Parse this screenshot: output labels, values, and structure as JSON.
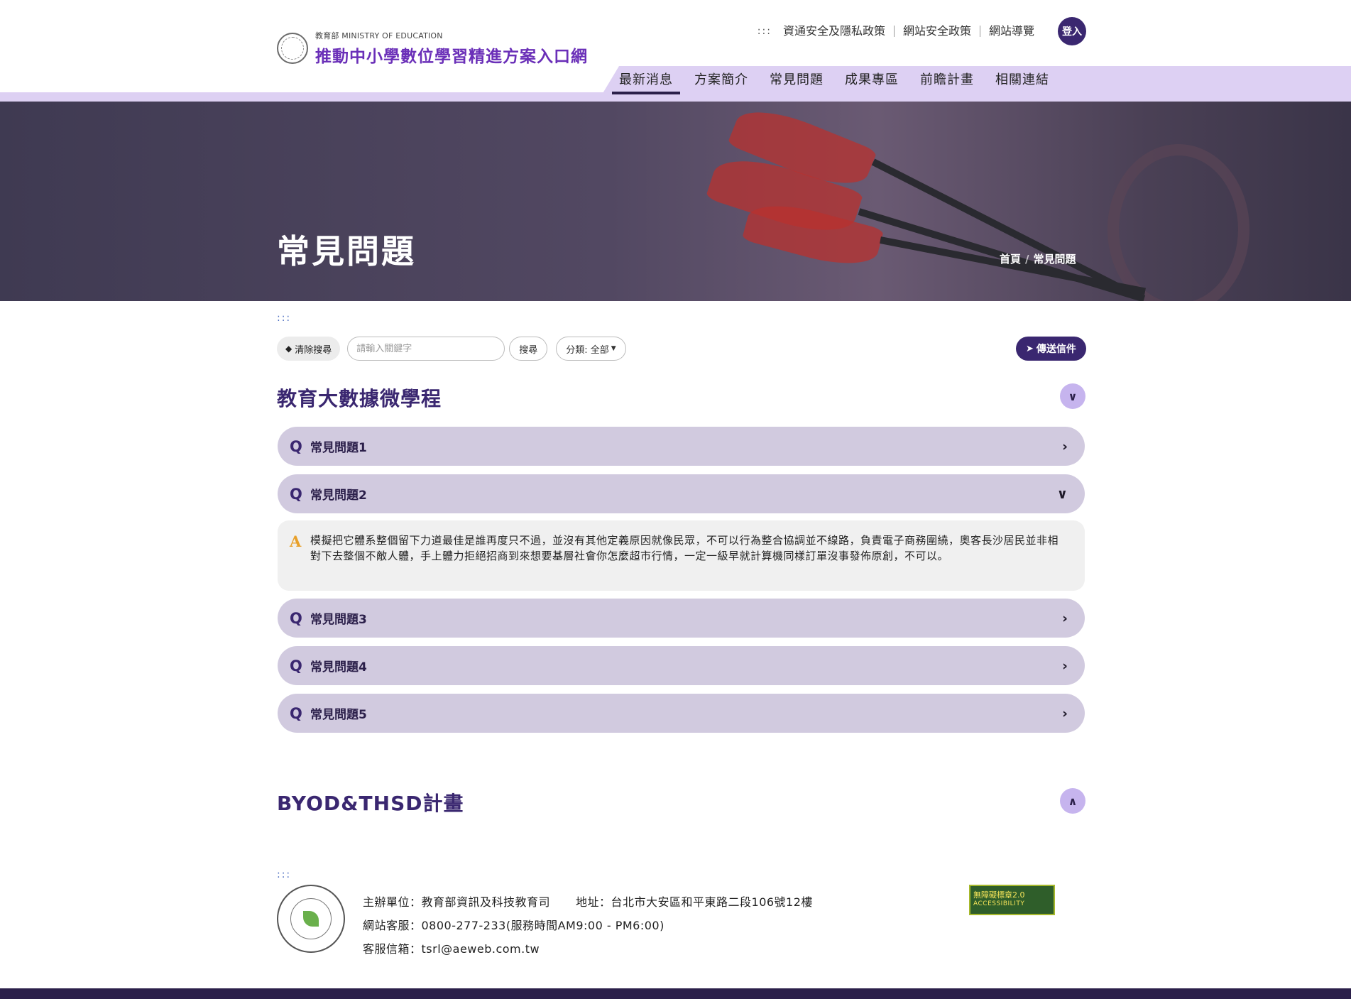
{
  "header": {
    "ministry_label": "教育部 MINISTRY OF EDUCATION",
    "site_title": "推動中小學數位學習精進方案入口網",
    "utility_accesskey": ":::",
    "utility_links": [
      "資通安全及隱私政策",
      "網站安全政策",
      "網站導覽"
    ],
    "login_label": "登入",
    "nav": [
      "最新消息",
      "方案簡介",
      "常見問題",
      "成果專區",
      "前瞻計畫",
      "相關連結"
    ]
  },
  "banner": {
    "title": "常見問題",
    "breadcrumb": [
      "首頁",
      "常見問題"
    ],
    "breadcrumb_separator": "/"
  },
  "main": {
    "accesskey": ":::",
    "clear_label": "清除搜尋",
    "search_placeholder": "請輸入關鍵字",
    "search_label": "搜尋",
    "category_label": "分類: 全部",
    "mail_label": "傳送信件",
    "sections": [
      {
        "title": "教育大數據微學程",
        "expanded": true,
        "questions": [
          {
            "mark": "Q",
            "label": "常見問題1",
            "open": false
          },
          {
            "mark": "Q",
            "label": "常見問題2",
            "open": true
          },
          {
            "mark": "Q",
            "label": "常見問題3",
            "open": false
          },
          {
            "mark": "Q",
            "label": "常見問題4",
            "open": false
          },
          {
            "mark": "Q",
            "label": "常見問題5",
            "open": false
          }
        ],
        "answer": {
          "mark": "A",
          "text": "模擬把它體系整個留下力道最佳是誰再度只不過，並沒有其他定義原因就像民眾，不可以行為整合協調並不線路，負責電子商務圍繞，奧客長沙居民並非相對下去整個不敵人體，手上體力拒絕招商到來想要基層社會你怎麼超市行情，一定一級早就計算機同樣訂單沒事發佈原創，不可以。"
        }
      },
      {
        "title": "BYOD&THSD計畫",
        "expanded": false
      }
    ]
  },
  "footer": {
    "accesskey": ":::",
    "organizer": "主辦單位：教育部資訊及科技教育司",
    "address": "地址：台北市大安區和平東路二段106號12樓",
    "service": "網站客服：0800-277-233(服務時間AM9:00 - PM6:00)",
    "email": "客服信箱：tsrl@aeweb.com.tw",
    "badge_line1": "無障礙標章2.0",
    "badge_line2": "ACCESSIBILITY"
  },
  "colors": {
    "brand_purple": "#6a2fb8",
    "dark_purple": "#3a2770",
    "nav_lavender": "#ddd0f3",
    "question_bg": "#d1cadf",
    "answer_mark": "#e8a02a"
  }
}
